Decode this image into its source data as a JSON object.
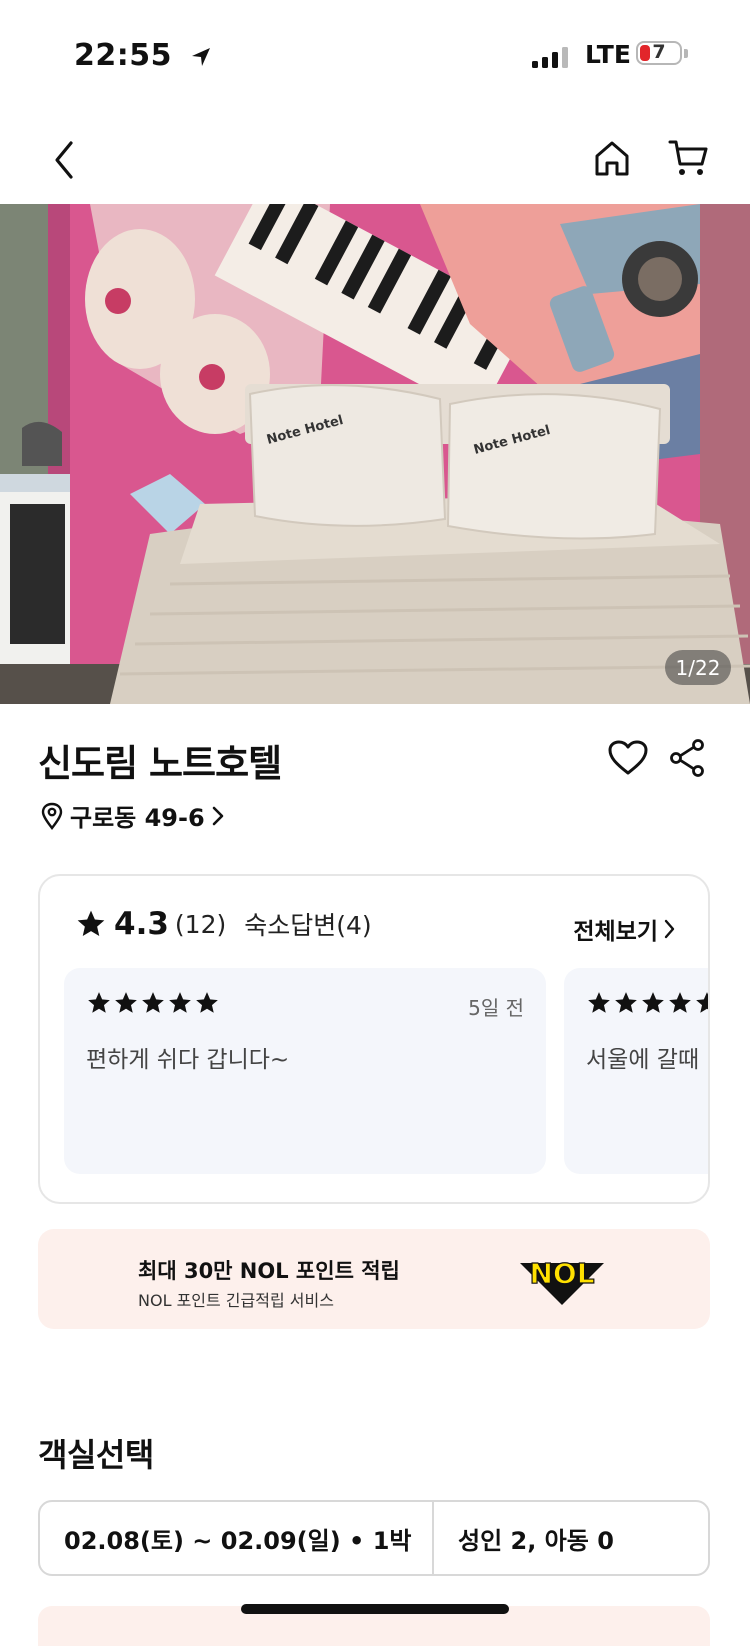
{
  "status_bar": {
    "time": "22:55",
    "network": "LTE",
    "battery": "7"
  },
  "gallery": {
    "counter": "1/22"
  },
  "hotel": {
    "name": "신도림 노트호텔",
    "address": "구로동 49-6"
  },
  "reviews": {
    "score": "4.3",
    "count": "(12)",
    "reply_label": "숙소답변(4)",
    "view_all": "전체보기",
    "items": [
      {
        "rating": 5,
        "date": "5일 전",
        "text": "편하게 쉬다 갑니다~"
      },
      {
        "rating": 5,
        "date": "",
        "text": "서울에 갈때"
      }
    ]
  },
  "nol_banner": {
    "title": "최대 30만 NOL 포인트 적립",
    "subtitle": "NOL 포인트 긴급적립 서비스",
    "logo_text": "NOL"
  },
  "room_select": {
    "title": "객실선택",
    "date_range": "02.08(토) ~ 02.09(일) • 1박",
    "guests": "성인 2, 아동 0"
  },
  "icons": {
    "back": "chevron-left-icon",
    "home": "home-icon",
    "cart": "cart-icon",
    "heart": "heart-icon",
    "share": "share-icon",
    "location": "location-pin-icon",
    "star": "star-icon"
  },
  "colors": {
    "banner_bg": "#fdf0ec",
    "review_bg": "#f4f6fb",
    "nol_yellow": "#ffe100"
  }
}
